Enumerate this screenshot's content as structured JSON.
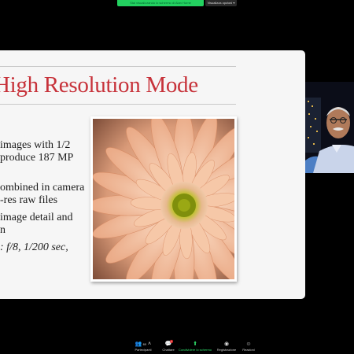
{
  "banner": {
    "sharing_text": "Stai visualizzando lo schermo di Alan Horne",
    "view_options_label": "Visualizza opzioni"
  },
  "slide": {
    "title": "High Resolution Mode",
    "bullets": [
      "images with 1/2",
      "produce 187 MP",
      "ombined in camera",
      "-res raw files",
      "image detail and",
      "n",
      ":  f/8, 1/200 sec,"
    ]
  },
  "toolbar": {
    "items": [
      {
        "label": "Partecipanti",
        "icon": "participants-icon",
        "count": "60"
      },
      {
        "label": "Chattare",
        "icon": "chat-icon",
        "badge": "1"
      },
      {
        "label": "Condividere lo schermo",
        "icon": "share-screen-icon"
      },
      {
        "label": "Registrazione",
        "icon": "record-icon"
      },
      {
        "label": "Reazioni",
        "icon": "reactions-icon"
      }
    ]
  },
  "colors": {
    "title_red": "#c7323a",
    "share_green": "#23d160"
  }
}
